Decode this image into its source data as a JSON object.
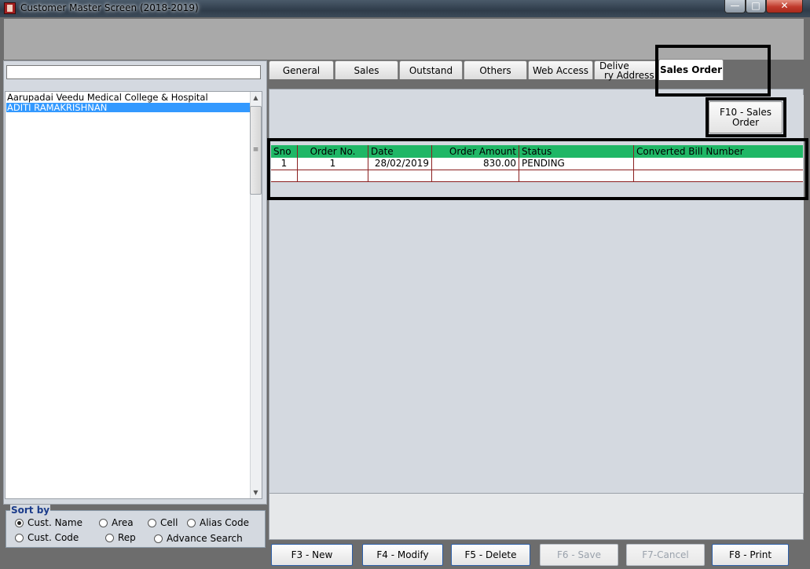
{
  "window": {
    "title": "Customer Master Screen (2018-2019)",
    "minimize": "—",
    "maximize": "□",
    "close": "✕"
  },
  "search": {
    "value": ""
  },
  "customers": [
    {
      "name": "Aarupadai Veedu Medical College & Hospital",
      "selected": false
    },
    {
      "name": "ADITI RAMAKRISHNAN",
      "selected": true
    }
  ],
  "tabs": [
    {
      "label": "General"
    },
    {
      "label": "Sales"
    },
    {
      "label": "Outstand"
    },
    {
      "label": "Others"
    },
    {
      "label": "Web Access"
    },
    {
      "label_line1": "Delive",
      "label_line2": "ry Address"
    },
    {
      "label": "Sales Order",
      "active": true
    }
  ],
  "sort": {
    "label": "Sort by",
    "options": [
      {
        "label": "Cust. Name",
        "checked": true
      },
      {
        "label": "Area",
        "checked": false
      },
      {
        "label": "Cell",
        "checked": false
      },
      {
        "label": "Alias Code",
        "checked": false
      },
      {
        "label": "Cust. Code",
        "checked": false
      },
      {
        "label": "Rep",
        "checked": false
      },
      {
        "label": "Advance Search",
        "checked": false
      }
    ]
  },
  "sales_order": {
    "new_button_line1": "F10 - Sales",
    "new_button_line2": "Order",
    "columns": [
      "Sno",
      "Order No.",
      "Date",
      "Order Amount",
      "Status",
      "Converted Bill Number"
    ],
    "rows": [
      {
        "sno": "1",
        "order_no": "1",
        "date": "28/02/2019",
        "amount": "830.00",
        "status": "PENDING",
        "bill": ""
      }
    ]
  },
  "actions": [
    {
      "label": "F3 - New",
      "enabled": true
    },
    {
      "label": "F4 - Modify",
      "enabled": true
    },
    {
      "label": "F5 - Delete",
      "enabled": true
    },
    {
      "label": "F6 - Save",
      "enabled": false
    },
    {
      "label": "F7-Cancel",
      "enabled": false
    },
    {
      "label": "F8 - Print",
      "enabled": true
    }
  ],
  "colors": {
    "grid_header": "#1fb766",
    "selection": "#3399ff",
    "highlight_border": "#000000"
  }
}
